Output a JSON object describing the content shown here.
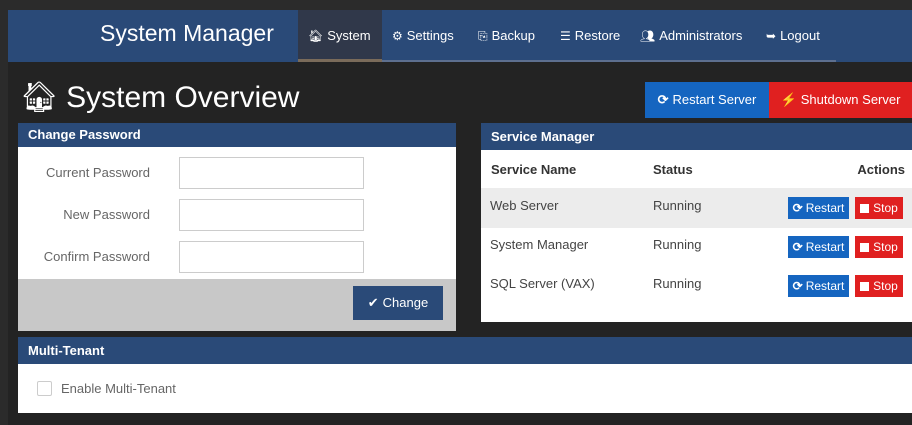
{
  "nav": {
    "brand": "System Manager",
    "items": [
      {
        "icon": "home-icon",
        "glyph": "🏠︎",
        "label": "System"
      },
      {
        "icon": "cogs-icon",
        "glyph": "⚙",
        "label": "Settings"
      },
      {
        "icon": "backup-icon",
        "glyph": "⎘",
        "label": "Backup"
      },
      {
        "icon": "database-icon",
        "glyph": "☰",
        "label": "Restore"
      },
      {
        "icon": "users-icon",
        "glyph": "👥︎",
        "label": "Administrators"
      },
      {
        "icon": "sign-out-icon",
        "glyph": "➥",
        "label": "Logout"
      }
    ]
  },
  "page": {
    "title_icon": "🏠︎",
    "title": "System Overview",
    "restart_server_label": "Restart Server",
    "shutdown_server_label": "Shutdown Server"
  },
  "change_password": {
    "header": "Change Password",
    "current_label": "Current Password",
    "new_label": "New Password",
    "confirm_label": "Confirm Password",
    "current_value": "",
    "new_value": "",
    "confirm_value": "",
    "change_label": "Change"
  },
  "service_manager": {
    "header": "Service Manager",
    "columns": [
      "Service Name",
      "Status",
      "Actions"
    ],
    "rows": [
      {
        "name": "Web Server",
        "status": "Running"
      },
      {
        "name": "System Manager",
        "status": "Running"
      },
      {
        "name": "SQL Server (VAX)",
        "status": "Running"
      }
    ],
    "restart_label": "Restart",
    "stop_label": "Stop"
  },
  "multi_tenant": {
    "header": "Multi-Tenant",
    "enable_label": "Enable Multi-Tenant",
    "enabled": false
  },
  "colors": {
    "nav_bg": "#2a4a78",
    "primary": "#1565c0",
    "danger": "#e02020"
  }
}
